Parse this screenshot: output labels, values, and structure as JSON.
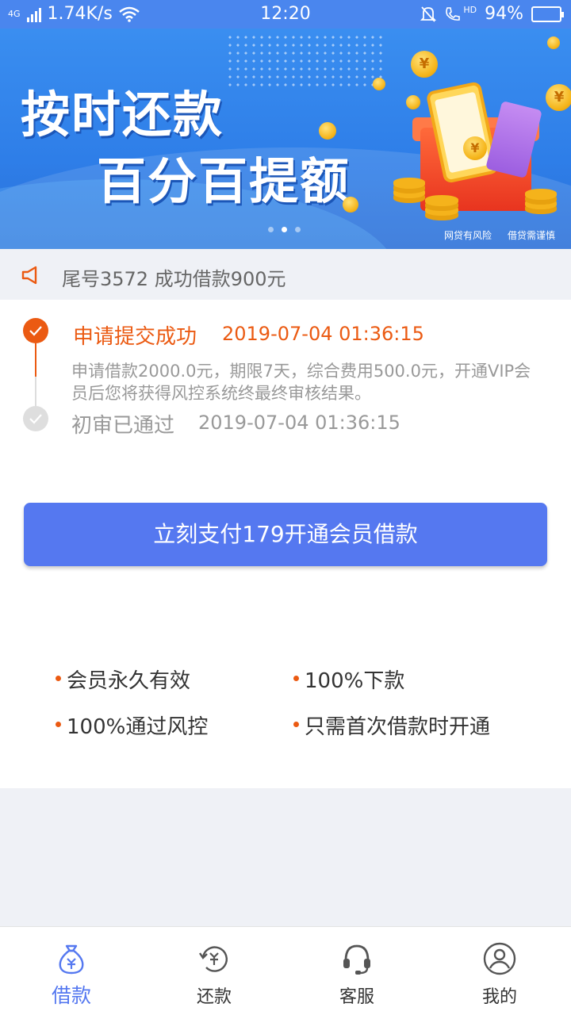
{
  "status_bar": {
    "network_type": "4G",
    "speed": "1.74K/s",
    "time": "12:20",
    "hd": "HD",
    "battery": "94%"
  },
  "banner": {
    "line1": "按时还款",
    "line2": "百分百提额",
    "disclaimer_1": "网贷有风险",
    "disclaimer_2": "借贷需谨慎",
    "coin_symbol": "¥"
  },
  "notice": {
    "text": "尾号3572 成功借款900元"
  },
  "progress": {
    "step1": {
      "title": "申请提交成功",
      "time": "2019-07-04 01:36:15",
      "desc": "申请借款2000.0元，期限7天，综合费用500.0元，开通VIP会员后您将获得风控系统终最终审核结果。"
    },
    "step2": {
      "title": "初审已通过",
      "time": "2019-07-04 01:36:15"
    }
  },
  "pay_button": {
    "label": "立刻支付179开通会员借款"
  },
  "features": [
    "会员永久有效",
    "100%下款",
    "100%通过风控",
    "只需首次借款时开通"
  ],
  "tabs": [
    {
      "label": "借款",
      "icon": "money-bag-icon"
    },
    {
      "label": "还款",
      "icon": "repay-icon"
    },
    {
      "label": "客服",
      "icon": "headset-icon"
    },
    {
      "label": "我的",
      "icon": "user-icon"
    }
  ],
  "colors": {
    "accent": "#5578f0",
    "orange": "#eb5a12",
    "banner_blue": "#3a8ef0"
  }
}
